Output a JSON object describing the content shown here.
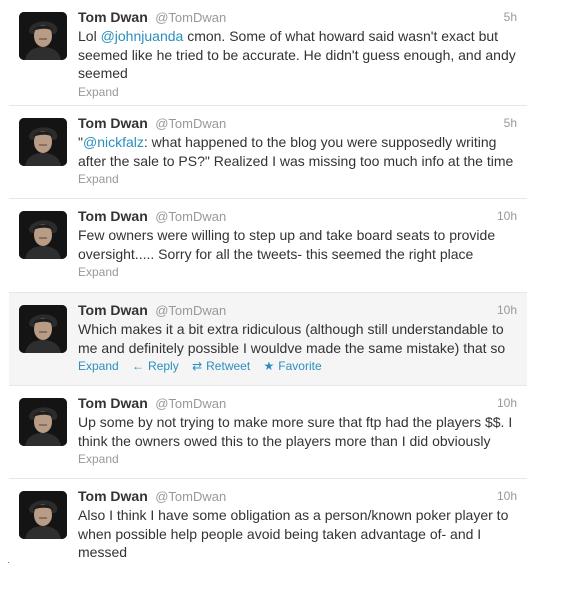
{
  "tweets": [
    {
      "name": "Tom Dwan",
      "handle": "@TomDwan",
      "time": "5h",
      "text_pre": "Lol ",
      "mention": "@johnjuanda",
      "text_post": " cmon. Some of what howard said wasn't exact but seemed like he tried to be accurate. He didn't guess enough, and andy seemed",
      "expand": "Expand"
    },
    {
      "name": "Tom Dwan",
      "handle": "@TomDwan",
      "time": "5h",
      "text_pre": "\"",
      "mention": "@nickfalz",
      "text_post": ": what happened to the blog you were supposedly writing after the sale to PS?\" Realized I was missing too much info at the time",
      "expand": "Expand"
    },
    {
      "name": "Tom Dwan",
      "handle": "@TomDwan",
      "time": "10h",
      "text": "Few owners were willing to step up and take board seats to provide oversight..... Sorry for all the tweets- this seemed the right place",
      "expand": "Expand"
    },
    {
      "name": "Tom Dwan",
      "handle": "@TomDwan",
      "time": "10h",
      "text": "Which makes it a bit extra ridiculous (although still understandable to me and definitely possible I wouldve made the same mistake) that so",
      "expand": "Expand",
      "reply": "Reply",
      "retweet": "Retweet",
      "favorite": "Favorite"
    },
    {
      "name": "Tom Dwan",
      "handle": "@TomDwan",
      "time": "10h",
      "text": "Up some by not trying to make more sure that ftp had the players $$. I think the owners owed this to the players more than I did obviously",
      "expand": "Expand"
    },
    {
      "name": "Tom Dwan",
      "handle": "@TomDwan",
      "time": "10h",
      "text": "Also I think I have some obligation as a person/known poker player to when possible help people avoid being taken advantage of- and I messed"
    }
  ],
  "icons": {
    "reply": "reply-arrow-icon",
    "retweet": "retweet-icon",
    "favorite": "star-icon"
  },
  "colors": {
    "link": "#2a8fbd",
    "muted": "#999999",
    "hover_bg": "#f5f5f5",
    "divider": "#e6e6e6"
  }
}
